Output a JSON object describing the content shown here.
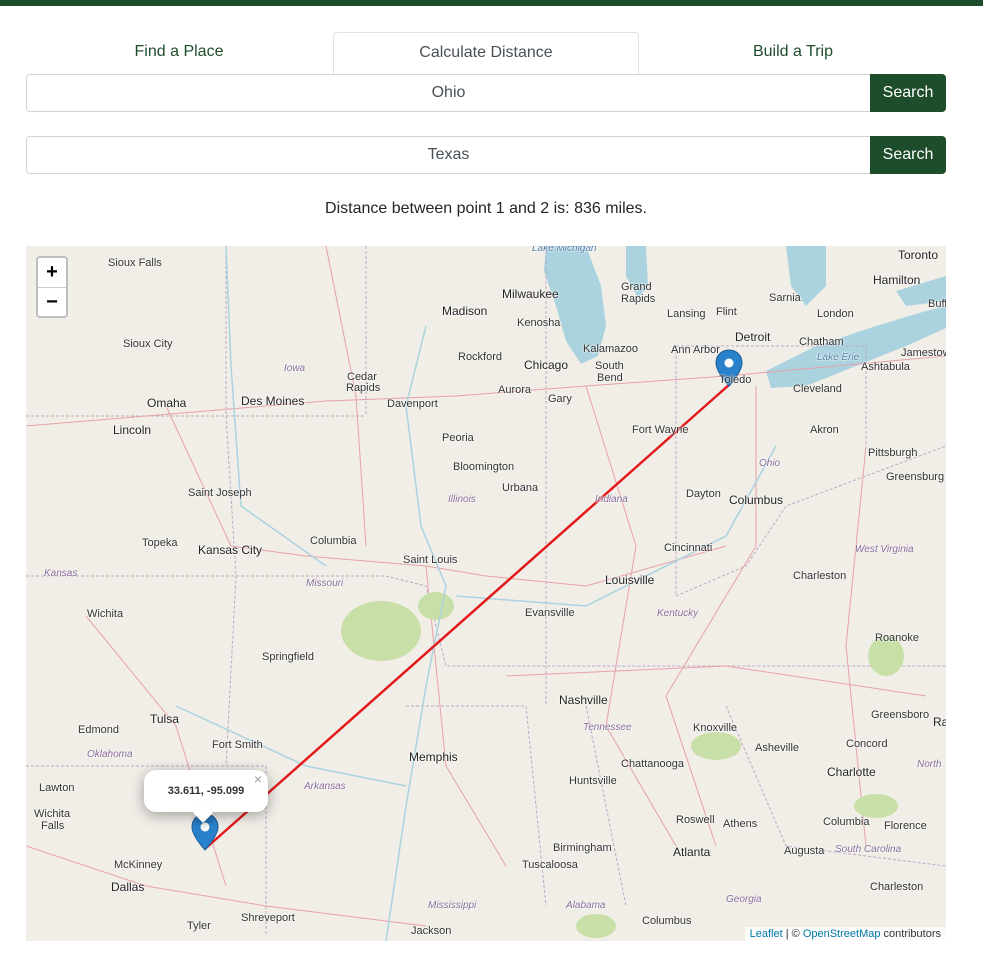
{
  "tabs": [
    {
      "label": "Find a Place"
    },
    {
      "label": "Calculate Distance"
    },
    {
      "label": "Build a Trip"
    }
  ],
  "point1": {
    "value": "Ohio",
    "button": "Search"
  },
  "point2": {
    "value": "Texas",
    "button": "Search"
  },
  "result": "Distance between point 1 and 2 is: 836 miles.",
  "map": {
    "zoom_in": "+",
    "zoom_out": "−",
    "popup": "33.611, -95.099",
    "popup_close": "×",
    "attribution": {
      "leaflet": "Leaflet",
      "separator": " | © ",
      "osm": "OpenStreetMap",
      "suffix": " contributors"
    },
    "route_color": "#e31a1c",
    "labels": {
      "lake_michigan": "Lake Michigan",
      "toronto": "Toronto",
      "sioux_falls": "Sioux Falls",
      "milwaukee": "Milwaukee",
      "grand_rapids": "Grand\nRapids",
      "flint": "Flint",
      "sarnia": "Sarnia",
      "hamilton": "Hamilton",
      "buff": "Buff",
      "madison": "Madison",
      "kenosha": "Kenosha",
      "lansing": "Lansing",
      "detroit": "Detroit",
      "london": "London",
      "sioux_city": "Sioux City",
      "kalamazoo": "Kalamazoo",
      "ann_arbor": "Ann Arbor",
      "chatham": "Chatham",
      "jamestown": "Jamestow",
      "iowa": "Iowa",
      "rockford": "Rockford",
      "chicago": "Chicago",
      "south_bend": "South\nBend",
      "toledo": "Toledo",
      "lake_erie": "Lake Erie",
      "ashtabula": "Ashtabula",
      "cedar_rapids": "Cedar\nRapids",
      "omaha": "Omaha",
      "des_moines": "Des Moines",
      "davenport": "Davenport",
      "aurora": "Aurora",
      "gary": "Gary",
      "cleveland": "Cleveland",
      "lincoln": "Lincoln",
      "peoria": "Peoria",
      "fort_wayne": "Fort Wayne",
      "akron": "Akron",
      "ohio": "Ohio",
      "bloomington": "Bloomington",
      "pittsburgh": "Pittsburgh",
      "illinois": "Illinois",
      "urbana": "Urbana",
      "saint_joseph": "Saint Joseph",
      "indiana": "Indiana",
      "dayton": "Dayton",
      "columbus": "Columbus",
      "greensburg": "Greensburg",
      "topeka": "Topeka",
      "columbia": "Columbia",
      "kansas_city": "Kansas City",
      "cincinnati": "Cincinnati",
      "west_virginia": "West Virginia",
      "kansas": "Kansas",
      "saint_louis": "Saint Louis",
      "missouri": "Missouri",
      "louisville": "Louisville",
      "charleston": "Charleston",
      "wichita": "Wichita",
      "evansville": "Evansville",
      "kentucky": "Kentucky",
      "springfield": "Springfield",
      "roanoke": "Roanoke",
      "nashville": "Nashville",
      "edmond": "Edmond",
      "tulsa": "Tulsa",
      "tennessee": "Tennessee",
      "knoxville": "Knoxville",
      "greensboro": "Greensboro",
      "ra": "Ra",
      "oklahoma": "Oklahoma",
      "fort_smith": "Fort Smith",
      "asheville": "Asheville",
      "concord": "Concord",
      "memphis": "Memphis",
      "chattanooga": "Chattanooga",
      "charlotte": "Charlotte",
      "north": "North",
      "lawton": "Lawton",
      "arkansas": "Arkansas",
      "huntsville": "Huntsville",
      "wichita_falls": "Wichita\nFalls",
      "roswell": "Roswell",
      "athens": "Athens",
      "columbia_sc": "Columbia",
      "florence": "Florence",
      "birmingham": "Birmingham",
      "atlanta": "Atlanta",
      "augusta": "Augusta",
      "south_carolina": "South Carolina",
      "mckinney": "McKinney",
      "tuscaloosa": "Tuscaloosa",
      "dallas": "Dallas",
      "charleston_sc": "Charleston",
      "mississippi": "Mississippi",
      "alabama": "Alabama",
      "georgia": "Georgia",
      "shreveport": "Shreveport",
      "columbus_ga": "Columbus",
      "tyler": "Tyler",
      "jackson": "Jackson"
    }
  }
}
